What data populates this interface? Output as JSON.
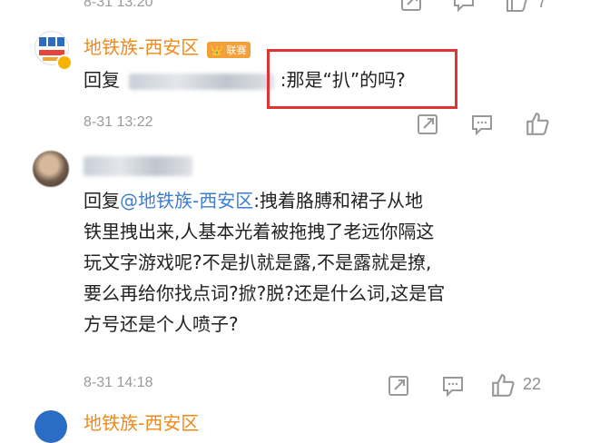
{
  "comments": [
    {
      "time": "8-31 13:20",
      "like_count": "7"
    },
    {
      "author": "地铁族-西安区",
      "badge": "联赛",
      "reply_prefix": "回复",
      "text": ":那是“扒”的吗?",
      "time": "8-31 13:22"
    },
    {
      "reply_prefix": "回复",
      "mention": "@地铁族-西安区",
      "text_line1": ":拽着胳膊和裙子从地",
      "text_line2": "铁里拽出来,人基本光着被拖拽了老远你隔这",
      "text_line3": "玩文字游戏呢?不是扒就是露,不是露就是撩,",
      "text_line4": "要么再给你找点词?掀?脱?还是什么词,这是官",
      "text_line5": "方号还是个人喷子?",
      "time": "8-31 14:18",
      "like_count": "22"
    },
    {
      "author": "地铁族-西安区"
    }
  ],
  "colors": {
    "accent_orange": "#f08a1c",
    "mention_blue": "#3d7ed1",
    "highlight_red": "#e03333",
    "meta_gray": "#9a9a9a"
  },
  "icons": [
    "share-icon",
    "comment-icon",
    "like-icon",
    "avatar"
  ]
}
